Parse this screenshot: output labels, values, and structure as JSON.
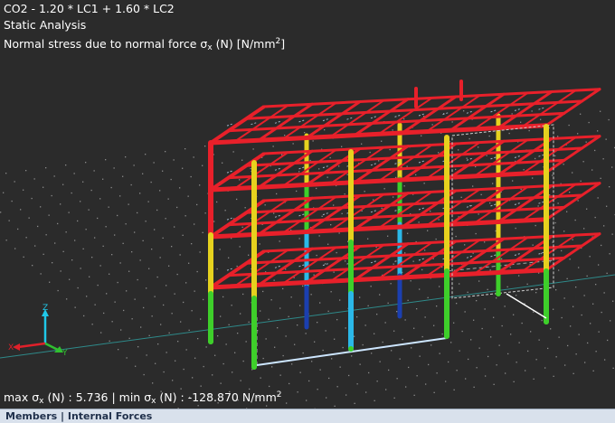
{
  "header": {
    "combo": "CO2 - 1.20 * LC1 + 1.60 * LC2",
    "analysis": "Static Analysis",
    "result_prefix": "Normal stress due to normal force σ",
    "result_sub": "x",
    "result_mid": " (N) [N/mm",
    "result_sup": "2",
    "result_end": "]"
  },
  "axes": {
    "x": "X",
    "y": "Y",
    "z": "Z"
  },
  "footer": {
    "max_prefix": "max σ",
    "max_sub": "x",
    "max_mid": " (N) : 5.736 | min σ",
    "min_sub": "x",
    "min_mid": " (N) : -128.870 N/mm",
    "min_sup": "2"
  },
  "panel": {
    "title": "Members | Internal Forces"
  },
  "colors": {
    "background": "#2b2b2b",
    "beam": "#e8202a",
    "column_yellow": "#e6d21e",
    "column_green": "#3ecf2a",
    "column_cyan": "#2bb8e8",
    "column_blue": "#1b3fb0",
    "axis_x": "#e0202a",
    "axis_y": "#30c030",
    "axis_z": "#20c8e8",
    "grid_dot": "#8a8a8a"
  }
}
